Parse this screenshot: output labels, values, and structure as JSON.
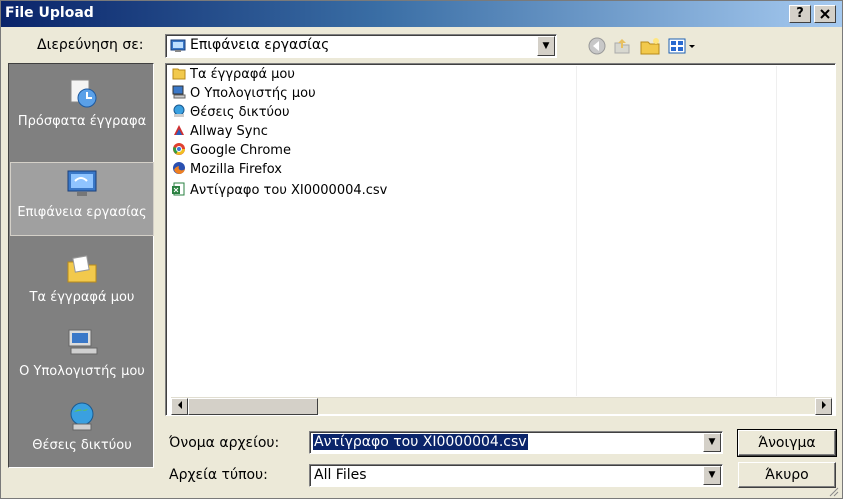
{
  "window": {
    "title": "File Upload",
    "help_label": "?",
    "close_label": "X"
  },
  "lookin": {
    "label": "Διερεύνηση σε:",
    "value": "Επιφάνεια εργασίας"
  },
  "toolbar": {
    "icons": [
      "back-icon",
      "up-folder-icon",
      "new-folder-icon",
      "view-menu-icon"
    ]
  },
  "places": [
    {
      "label": "Πρόσφατα έγγραφα",
      "icon": "recent-documents-icon"
    },
    {
      "label": "Επιφάνεια εργασίας",
      "icon": "desktop-icon",
      "active": true
    },
    {
      "label": "Τα έγγραφά μου",
      "icon": "my-documents-icon"
    },
    {
      "label": "Ο Υπολογιστής μου",
      "icon": "my-computer-icon"
    },
    {
      "label": "Θέσεις δικτύου",
      "icon": "network-places-icon"
    }
  ],
  "files": [
    {
      "name": "Τα έγγραφά μου",
      "icon": "folder-icon"
    },
    {
      "name": "Ο Υπολογιστής μου",
      "icon": "computer-icon"
    },
    {
      "name": "Θέσεις δικτύου",
      "icon": "network-icon"
    },
    {
      "name": "Allway Sync",
      "icon": "allway-sync-icon"
    },
    {
      "name": "Google Chrome",
      "icon": "chrome-icon"
    },
    {
      "name": "Mozilla Firefox",
      "icon": "firefox-icon"
    },
    {
      "name": "Αντίγραφο του XI0000004.csv",
      "icon": "csv-file-icon"
    }
  ],
  "filename": {
    "label": "Όνομα αρχείου:",
    "value": "Αντίγραφο του XI0000004.csv"
  },
  "filetype": {
    "label": "Αρχεία τύπου:",
    "value": "All Files"
  },
  "buttons": {
    "open": "Άνοιγμα",
    "cancel": "Άκυρο"
  },
  "colors": {
    "titlebar_start": "#0a246a",
    "titlebar_end": "#a6caf0",
    "places_bg": "#808080",
    "selection": "#0a246a"
  }
}
